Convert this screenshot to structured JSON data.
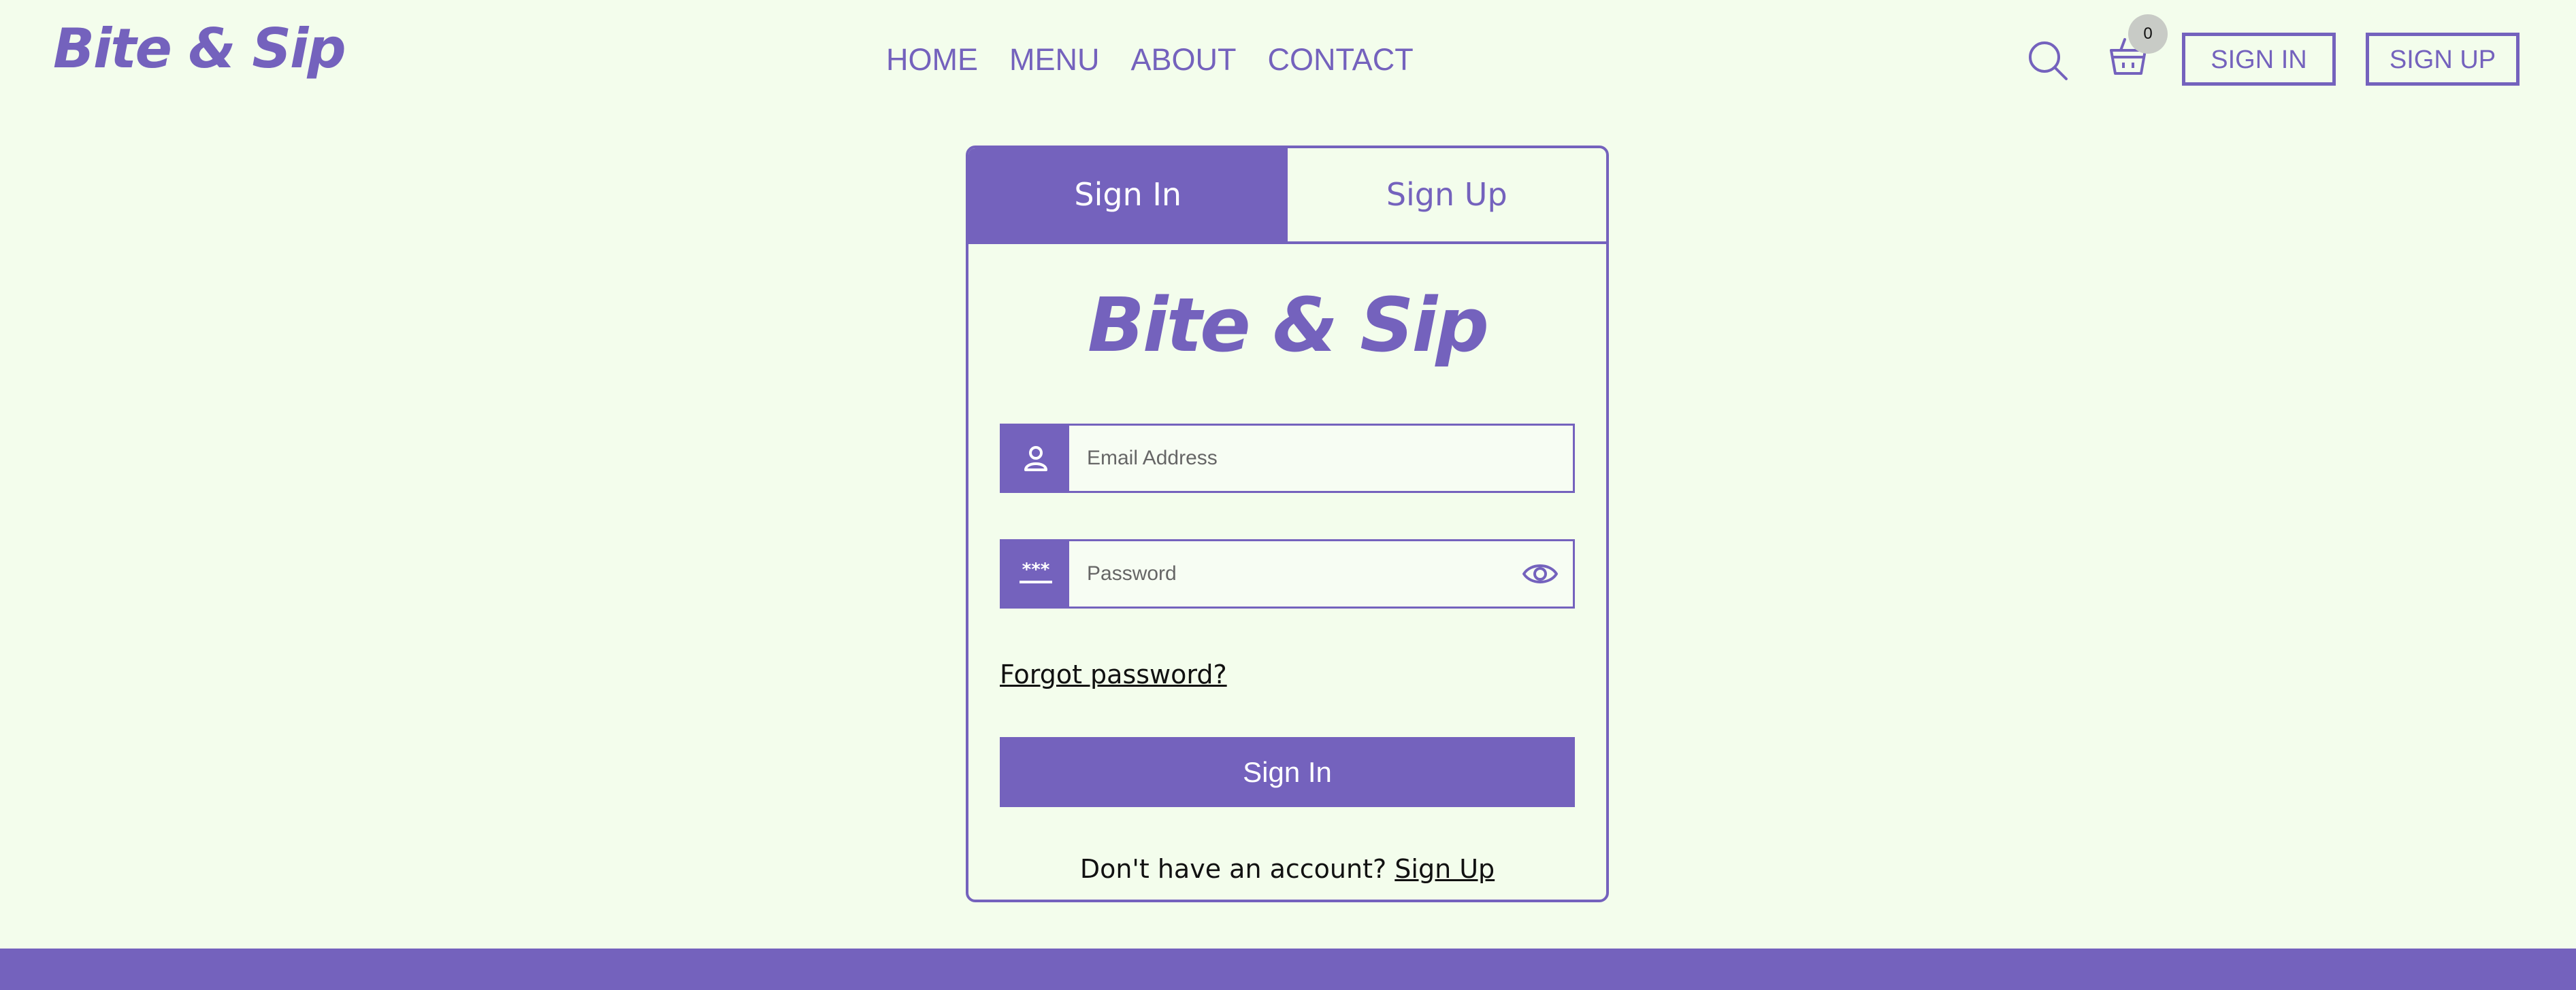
{
  "header": {
    "logo": "Bite & Sip",
    "nav": [
      "HOME",
      "MENU",
      "ABOUT",
      "CONTACT"
    ],
    "cart_count": "0",
    "sign_in": "SIGN IN",
    "sign_up": "SIGN UP"
  },
  "card": {
    "tabs": {
      "sign_in": "Sign In",
      "sign_up": "Sign Up"
    },
    "logo": "Bite & Sip",
    "email_placeholder": "Email Address",
    "password_placeholder": "Password",
    "forgot": "Forgot password?",
    "submit": "Sign In",
    "no_account": "Don't have an account?",
    "sign_up_link": "Sign Up"
  },
  "colors": {
    "accent": "#7462bd",
    "background": "#f3fdec",
    "badge": "#c8cbc6"
  },
  "icons": [
    "search-icon",
    "cart-icon",
    "user-icon",
    "password-icon",
    "eye-icon"
  ]
}
